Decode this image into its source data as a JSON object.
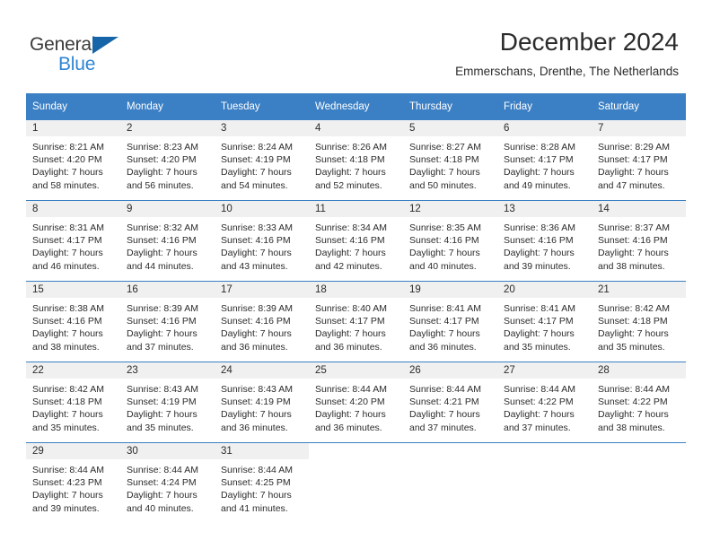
{
  "brand": {
    "name_part1": "General",
    "name_part2": "Blue",
    "triangle_color": "#1565a8",
    "blue_color": "#2f86d4"
  },
  "header": {
    "title": "December 2024",
    "location": "Emmerschans, Drenthe, The Netherlands"
  },
  "theme": {
    "header_blue": "#3b7fc4",
    "band_gray": "#f0f0f0"
  },
  "weekdays": [
    "Sunday",
    "Monday",
    "Tuesday",
    "Wednesday",
    "Thursday",
    "Friday",
    "Saturday"
  ],
  "weeks": [
    {
      "days": [
        {
          "num": "1",
          "sunrise": "Sunrise: 8:21 AM",
          "sunset": "Sunset: 4:20 PM",
          "daylight1": "Daylight: 7 hours",
          "daylight2": "and 58 minutes."
        },
        {
          "num": "2",
          "sunrise": "Sunrise: 8:23 AM",
          "sunset": "Sunset: 4:20 PM",
          "daylight1": "Daylight: 7 hours",
          "daylight2": "and 56 minutes."
        },
        {
          "num": "3",
          "sunrise": "Sunrise: 8:24 AM",
          "sunset": "Sunset: 4:19 PM",
          "daylight1": "Daylight: 7 hours",
          "daylight2": "and 54 minutes."
        },
        {
          "num": "4",
          "sunrise": "Sunrise: 8:26 AM",
          "sunset": "Sunset: 4:18 PM",
          "daylight1": "Daylight: 7 hours",
          "daylight2": "and 52 minutes."
        },
        {
          "num": "5",
          "sunrise": "Sunrise: 8:27 AM",
          "sunset": "Sunset: 4:18 PM",
          "daylight1": "Daylight: 7 hours",
          "daylight2": "and 50 minutes."
        },
        {
          "num": "6",
          "sunrise": "Sunrise: 8:28 AM",
          "sunset": "Sunset: 4:17 PM",
          "daylight1": "Daylight: 7 hours",
          "daylight2": "and 49 minutes."
        },
        {
          "num": "7",
          "sunrise": "Sunrise: 8:29 AM",
          "sunset": "Sunset: 4:17 PM",
          "daylight1": "Daylight: 7 hours",
          "daylight2": "and 47 minutes."
        }
      ]
    },
    {
      "days": [
        {
          "num": "8",
          "sunrise": "Sunrise: 8:31 AM",
          "sunset": "Sunset: 4:17 PM",
          "daylight1": "Daylight: 7 hours",
          "daylight2": "and 46 minutes."
        },
        {
          "num": "9",
          "sunrise": "Sunrise: 8:32 AM",
          "sunset": "Sunset: 4:16 PM",
          "daylight1": "Daylight: 7 hours",
          "daylight2": "and 44 minutes."
        },
        {
          "num": "10",
          "sunrise": "Sunrise: 8:33 AM",
          "sunset": "Sunset: 4:16 PM",
          "daylight1": "Daylight: 7 hours",
          "daylight2": "and 43 minutes."
        },
        {
          "num": "11",
          "sunrise": "Sunrise: 8:34 AM",
          "sunset": "Sunset: 4:16 PM",
          "daylight1": "Daylight: 7 hours",
          "daylight2": "and 42 minutes."
        },
        {
          "num": "12",
          "sunrise": "Sunrise: 8:35 AM",
          "sunset": "Sunset: 4:16 PM",
          "daylight1": "Daylight: 7 hours",
          "daylight2": "and 40 minutes."
        },
        {
          "num": "13",
          "sunrise": "Sunrise: 8:36 AM",
          "sunset": "Sunset: 4:16 PM",
          "daylight1": "Daylight: 7 hours",
          "daylight2": "and 39 minutes."
        },
        {
          "num": "14",
          "sunrise": "Sunrise: 8:37 AM",
          "sunset": "Sunset: 4:16 PM",
          "daylight1": "Daylight: 7 hours",
          "daylight2": "and 38 minutes."
        }
      ]
    },
    {
      "days": [
        {
          "num": "15",
          "sunrise": "Sunrise: 8:38 AM",
          "sunset": "Sunset: 4:16 PM",
          "daylight1": "Daylight: 7 hours",
          "daylight2": "and 38 minutes."
        },
        {
          "num": "16",
          "sunrise": "Sunrise: 8:39 AM",
          "sunset": "Sunset: 4:16 PM",
          "daylight1": "Daylight: 7 hours",
          "daylight2": "and 37 minutes."
        },
        {
          "num": "17",
          "sunrise": "Sunrise: 8:39 AM",
          "sunset": "Sunset: 4:16 PM",
          "daylight1": "Daylight: 7 hours",
          "daylight2": "and 36 minutes."
        },
        {
          "num": "18",
          "sunrise": "Sunrise: 8:40 AM",
          "sunset": "Sunset: 4:17 PM",
          "daylight1": "Daylight: 7 hours",
          "daylight2": "and 36 minutes."
        },
        {
          "num": "19",
          "sunrise": "Sunrise: 8:41 AM",
          "sunset": "Sunset: 4:17 PM",
          "daylight1": "Daylight: 7 hours",
          "daylight2": "and 36 minutes."
        },
        {
          "num": "20",
          "sunrise": "Sunrise: 8:41 AM",
          "sunset": "Sunset: 4:17 PM",
          "daylight1": "Daylight: 7 hours",
          "daylight2": "and 35 minutes."
        },
        {
          "num": "21",
          "sunrise": "Sunrise: 8:42 AM",
          "sunset": "Sunset: 4:18 PM",
          "daylight1": "Daylight: 7 hours",
          "daylight2": "and 35 minutes."
        }
      ]
    },
    {
      "days": [
        {
          "num": "22",
          "sunrise": "Sunrise: 8:42 AM",
          "sunset": "Sunset: 4:18 PM",
          "daylight1": "Daylight: 7 hours",
          "daylight2": "and 35 minutes."
        },
        {
          "num": "23",
          "sunrise": "Sunrise: 8:43 AM",
          "sunset": "Sunset: 4:19 PM",
          "daylight1": "Daylight: 7 hours",
          "daylight2": "and 35 minutes."
        },
        {
          "num": "24",
          "sunrise": "Sunrise: 8:43 AM",
          "sunset": "Sunset: 4:19 PM",
          "daylight1": "Daylight: 7 hours",
          "daylight2": "and 36 minutes."
        },
        {
          "num": "25",
          "sunrise": "Sunrise: 8:44 AM",
          "sunset": "Sunset: 4:20 PM",
          "daylight1": "Daylight: 7 hours",
          "daylight2": "and 36 minutes."
        },
        {
          "num": "26",
          "sunrise": "Sunrise: 8:44 AM",
          "sunset": "Sunset: 4:21 PM",
          "daylight1": "Daylight: 7 hours",
          "daylight2": "and 37 minutes."
        },
        {
          "num": "27",
          "sunrise": "Sunrise: 8:44 AM",
          "sunset": "Sunset: 4:22 PM",
          "daylight1": "Daylight: 7 hours",
          "daylight2": "and 37 minutes."
        },
        {
          "num": "28",
          "sunrise": "Sunrise: 8:44 AM",
          "sunset": "Sunset: 4:22 PM",
          "daylight1": "Daylight: 7 hours",
          "daylight2": "and 38 minutes."
        }
      ]
    },
    {
      "days": [
        {
          "num": "29",
          "sunrise": "Sunrise: 8:44 AM",
          "sunset": "Sunset: 4:23 PM",
          "daylight1": "Daylight: 7 hours",
          "daylight2": "and 39 minutes."
        },
        {
          "num": "30",
          "sunrise": "Sunrise: 8:44 AM",
          "sunset": "Sunset: 4:24 PM",
          "daylight1": "Daylight: 7 hours",
          "daylight2": "and 40 minutes."
        },
        {
          "num": "31",
          "sunrise": "Sunrise: 8:44 AM",
          "sunset": "Sunset: 4:25 PM",
          "daylight1": "Daylight: 7 hours",
          "daylight2": "and 41 minutes."
        },
        {
          "num": "",
          "sunrise": "",
          "sunset": "",
          "daylight1": "",
          "daylight2": ""
        },
        {
          "num": "",
          "sunrise": "",
          "sunset": "",
          "daylight1": "",
          "daylight2": ""
        },
        {
          "num": "",
          "sunrise": "",
          "sunset": "",
          "daylight1": "",
          "daylight2": ""
        },
        {
          "num": "",
          "sunrise": "",
          "sunset": "",
          "daylight1": "",
          "daylight2": ""
        }
      ]
    }
  ]
}
